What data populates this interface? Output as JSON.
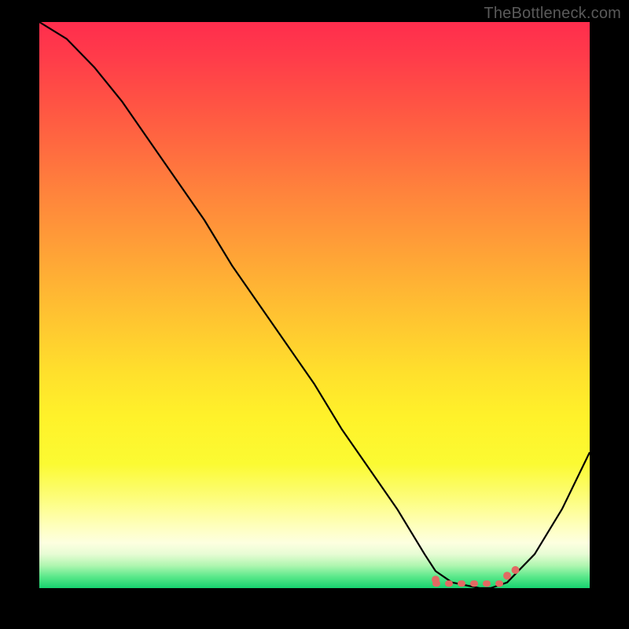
{
  "watermark": "TheBottleneck.com",
  "colors": {
    "background": "#000000",
    "gradient_top": "#ff2d4d",
    "gradient_mid": "#ffe02c",
    "gradient_bottom": "#17d36f",
    "line": "#000000",
    "marker": "#e26a63"
  },
  "chart_data": {
    "type": "line",
    "title": "",
    "xlabel": "",
    "ylabel": "",
    "xlim": [
      0,
      100
    ],
    "ylim": [
      0,
      100
    ],
    "x": [
      0,
      5,
      10,
      15,
      20,
      25,
      30,
      35,
      40,
      45,
      50,
      55,
      60,
      65,
      70,
      72,
      75,
      80,
      82,
      85,
      90,
      95,
      100
    ],
    "y": [
      100,
      97,
      92,
      86,
      79,
      72,
      65,
      57,
      50,
      43,
      36,
      28,
      21,
      14,
      6,
      3,
      1,
      0,
      0,
      1,
      6,
      14,
      24
    ],
    "flat_region_x": [
      72,
      85
    ],
    "annotations": []
  }
}
